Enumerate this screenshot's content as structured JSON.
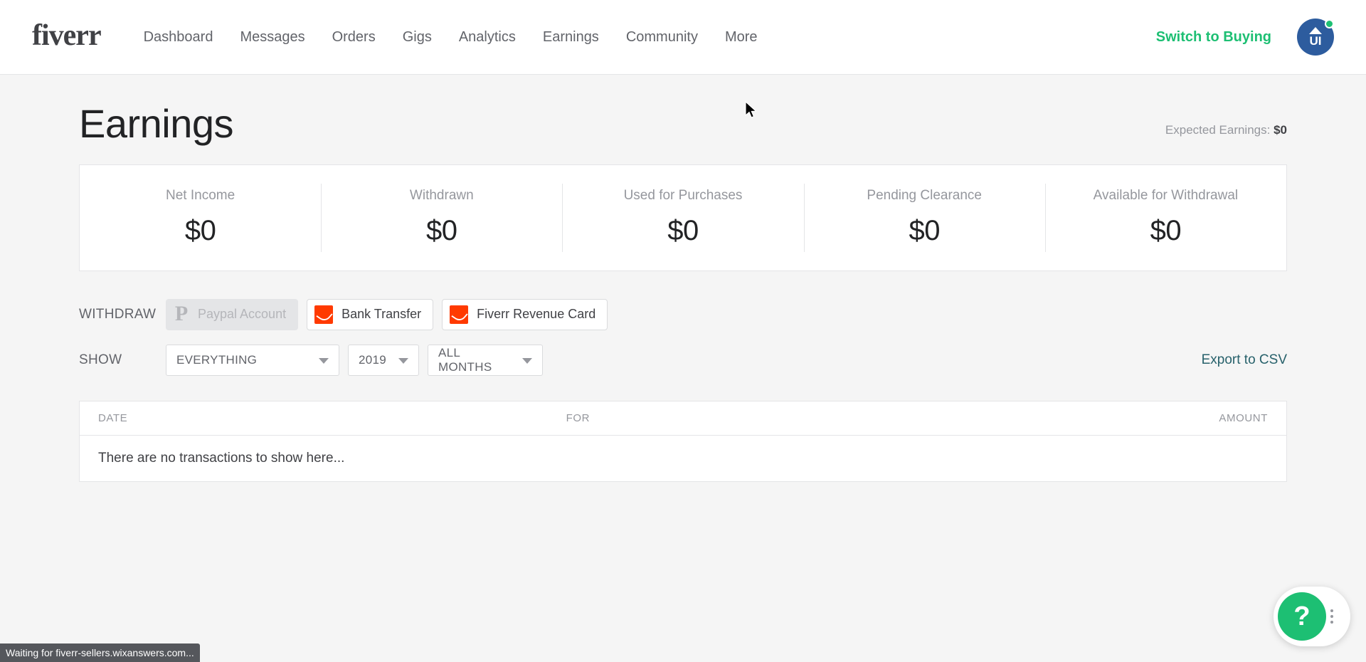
{
  "header": {
    "brand": "fiverr",
    "nav_items": [
      {
        "label": "Dashboard"
      },
      {
        "label": "Messages"
      },
      {
        "label": "Orders"
      },
      {
        "label": "Gigs"
      },
      {
        "label": "Analytics"
      },
      {
        "label": "Earnings"
      },
      {
        "label": "Community"
      },
      {
        "label": "More"
      }
    ],
    "switch_label": "Switch to Buying",
    "avatar_initials": "UI",
    "avatar_bg": "#2d5c9e",
    "status_dot_color": "#1dbf73"
  },
  "page": {
    "title": "Earnings",
    "expected_label": "Expected Earnings:",
    "expected_value": "$0"
  },
  "stats": [
    {
      "label": "Net Income",
      "value": "$0"
    },
    {
      "label": "Withdrawn",
      "value": "$0"
    },
    {
      "label": "Used for Purchases",
      "value": "$0"
    },
    {
      "label": "Pending Clearance",
      "value": "$0"
    },
    {
      "label": "Available for Withdrawal",
      "value": "$0"
    }
  ],
  "withdraw": {
    "label": "WITHDRAW",
    "methods": [
      {
        "label": "Paypal Account",
        "icon": "paypal-icon",
        "disabled": true
      },
      {
        "label": "Bank Transfer",
        "icon": "fiverr-logo-icon",
        "disabled": false
      },
      {
        "label": "Fiverr Revenue Card",
        "icon": "fiverr-logo-icon",
        "disabled": false
      }
    ]
  },
  "show": {
    "label": "SHOW",
    "filters": [
      {
        "name": "type-filter",
        "value": "EVERYTHING"
      },
      {
        "name": "year-filter",
        "value": "2019"
      },
      {
        "name": "month-filter",
        "value": "ALL MONTHS"
      }
    ],
    "export_label": "Export to CSV",
    "export_color": "#27616b"
  },
  "table": {
    "columns": [
      {
        "key": "date",
        "label": "DATE"
      },
      {
        "key": "for",
        "label": "FOR"
      },
      {
        "key": "amount",
        "label": "AMOUNT"
      }
    ],
    "rows": [],
    "empty_message": "There are no transactions to show here..."
  },
  "help_widget": {
    "button_glyph": "?",
    "button_color": "#1dbf73",
    "menu_icon": "kebab-menu-icon"
  },
  "browser": {
    "status_text": "Waiting for fiverr-sellers.wixanswers.com..."
  }
}
